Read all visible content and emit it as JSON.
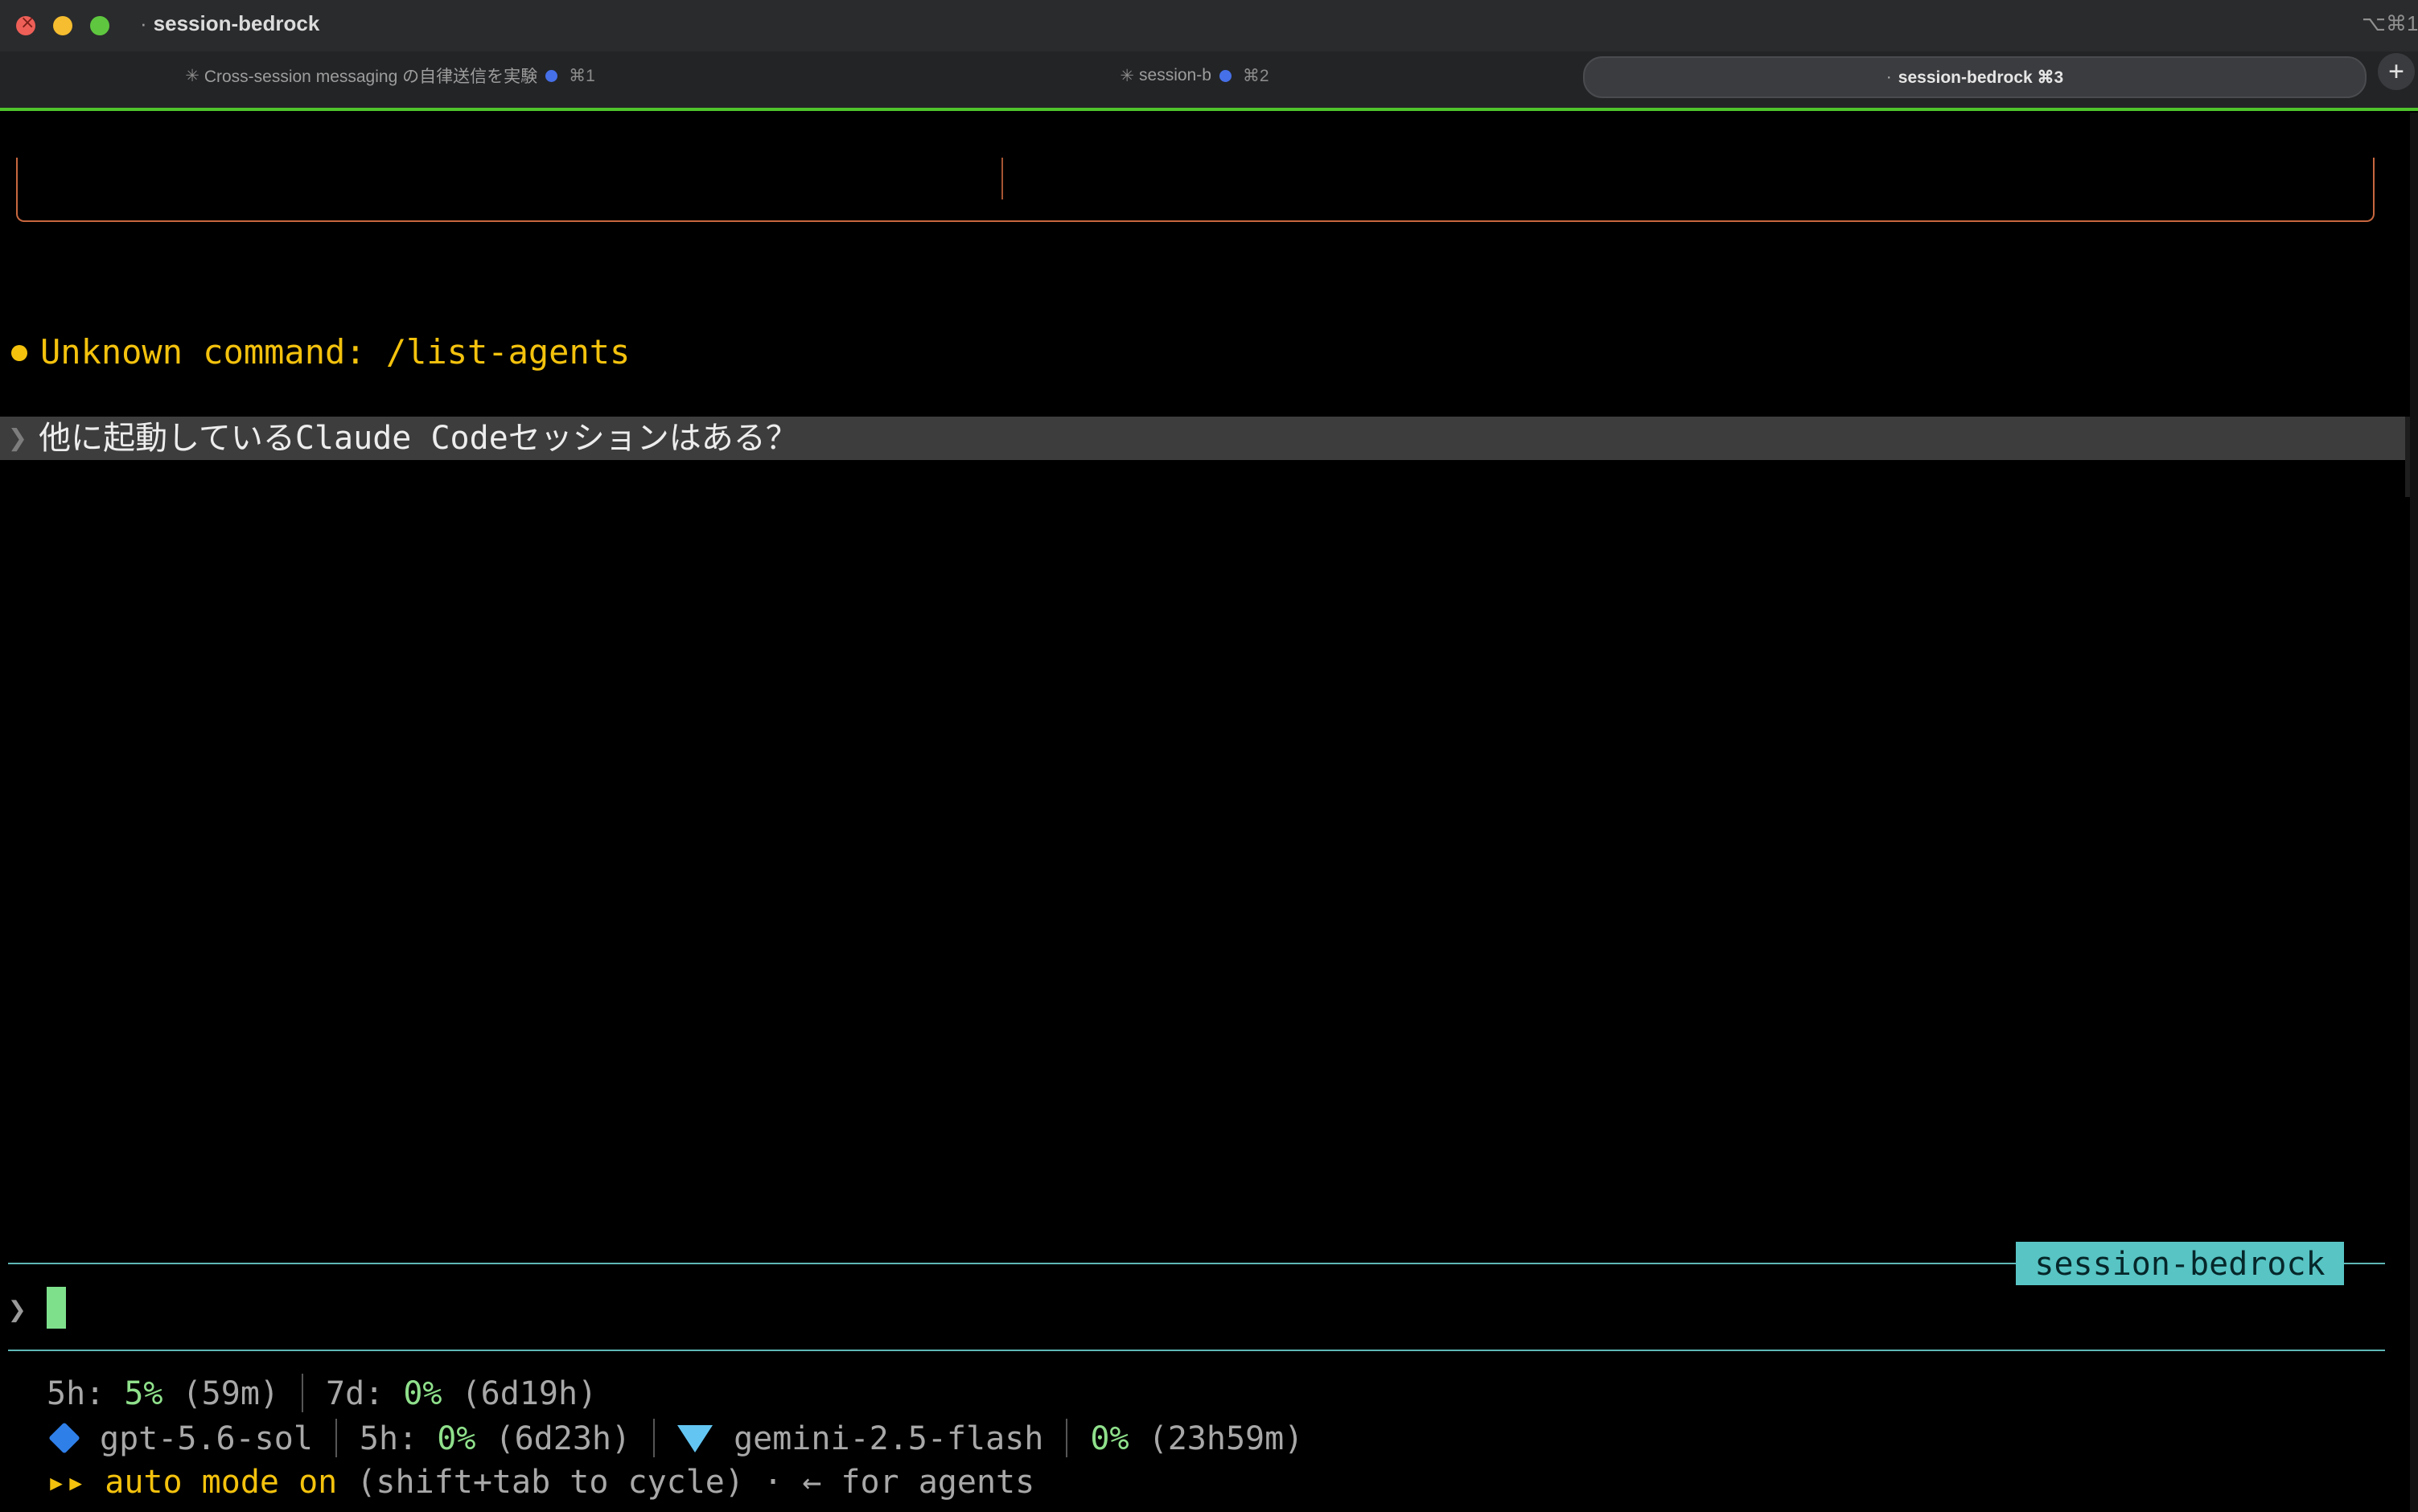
{
  "window": {
    "title_dot": "·",
    "title": "session-bedrock",
    "shortcut": "⌥⌘1"
  },
  "tabs": [
    {
      "spark": "✳",
      "label": "Cross-session messaging の自律送信を実験",
      "key": "⌘1"
    },
    {
      "spark": "✳",
      "label": "session-b",
      "key": "⌘2"
    },
    {
      "dot": "·",
      "label": "session-bedrock ⌘3"
    }
  ],
  "new_tab": "+",
  "terminal": {
    "message": "Unknown command: /list-agents",
    "user_chevron": "❯",
    "user_input": "他に起動しているClaude Codeセッションはある？",
    "session_label": "session-bedrock",
    "prompt_chevron": "❯"
  },
  "status": {
    "line1": {
      "a_label": "5h: ",
      "a_pct": "5%",
      "a_time": " (59m)",
      "b_label": "7d: ",
      "b_pct": "0%",
      "b_time": " (6d19h)"
    },
    "line2": {
      "model1_icon": "blue-diamond-icon",
      "model1": "gpt-5.6-sol",
      "m1_label": "5h: ",
      "m1_pct": "0%",
      "m1_time": " (6d23h)",
      "model2_icon": "gem-icon",
      "model2": "gemini-2.5-flash",
      "m2_pct": "0%",
      "m2_time": " (23h59m)"
    },
    "line3": {
      "arrows": "▸▸",
      "mode": "auto mode on",
      "hint": " (shift+tab to cycle) · ← for agents"
    }
  },
  "colors": {
    "accent_green": "#4fc32c",
    "warning_yellow": "#f4c20d",
    "teal": "#58c4c4",
    "cursor": "#7ee08b"
  }
}
